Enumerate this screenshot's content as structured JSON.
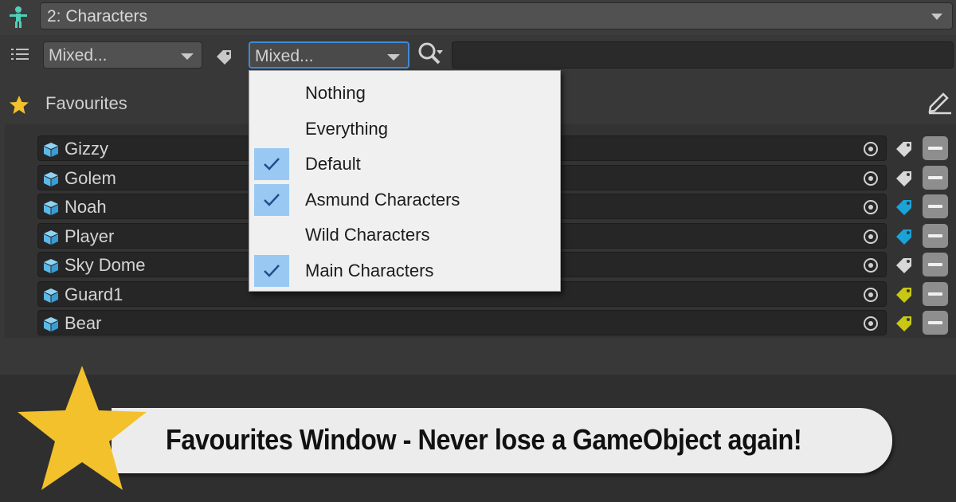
{
  "collection": {
    "selected": "2: Characters"
  },
  "filters": {
    "scene_filter": "Mixed...",
    "layer_filter": "Mixed...",
    "search_value": ""
  },
  "favourites": {
    "title": "Favourites",
    "items": [
      {
        "name": "Gizzy",
        "tag_color": "#d8d8d8"
      },
      {
        "name": "Golem",
        "tag_color": "#d8d8d8"
      },
      {
        "name": "Noah",
        "tag_color": "#1aa3d8"
      },
      {
        "name": "Player",
        "tag_color": "#1aa3d8"
      },
      {
        "name": "Sky Dome",
        "tag_color": "#d8d8d8"
      },
      {
        "name": "Guard1",
        "tag_color": "#c8c814"
      },
      {
        "name": "Bear",
        "tag_color": "#c8c814"
      }
    ]
  },
  "layer_menu": {
    "items": [
      {
        "label": "Nothing",
        "checked": false
      },
      {
        "label": "Everything",
        "checked": false
      },
      {
        "label": "Default",
        "checked": true
      },
      {
        "label": "Asmund Characters",
        "checked": true
      },
      {
        "label": "Wild Characters",
        "checked": false
      },
      {
        "label": "Main Characters",
        "checked": true
      }
    ]
  },
  "banner": {
    "text": "Favourites Window - Never lose a GameObject again!"
  },
  "colors": {
    "accent": "#3f8ad8",
    "check_highlight": "#99c9f2",
    "star": "#f3c12c",
    "cube": "#5ab8e8"
  }
}
